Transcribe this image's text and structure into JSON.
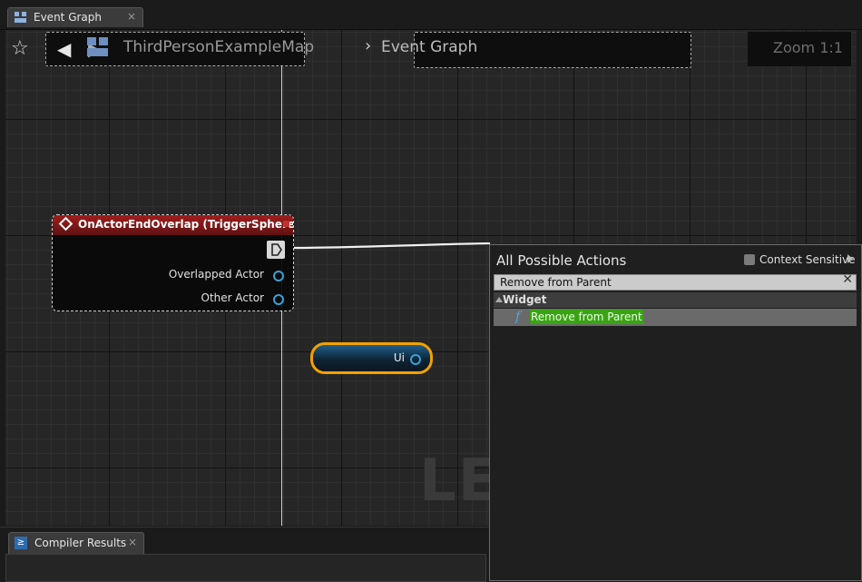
{
  "tab": {
    "label": "Event Graph",
    "close": "×",
    "icon": "event-graph-icon"
  },
  "toolbar": {
    "breadcrumb_level": "ThirdPersonExampleMap",
    "separator": "›",
    "breadcrumb_graph": "Event Graph",
    "zoom": "Zoom 1:1",
    "back_icon": "arrow-left-icon",
    "forward_icon": "arrow-right-icon",
    "favorite_icon": "star-icon"
  },
  "watermark": "LEV",
  "event_node": {
    "title": "OnActorEndOverlap (TriggerSphere)",
    "pins": [
      "Overlapped Actor",
      "Other Actor"
    ],
    "header_color": "#a11d1d"
  },
  "variable_node": {
    "label": "Ui",
    "border_color": "#f2a100"
  },
  "action_menu": {
    "title": "All Possible Actions",
    "context_sensitive_label": "Context Sensitive",
    "search_value": "Remove from Parent",
    "clear_icon": "close-icon",
    "category": "Widget",
    "items": [
      {
        "icon": "function-icon",
        "label": "Remove from Parent"
      }
    ],
    "highlight_color": "#3aa314"
  },
  "compiler_tab": {
    "label": "Compiler Results",
    "close": "×"
  }
}
